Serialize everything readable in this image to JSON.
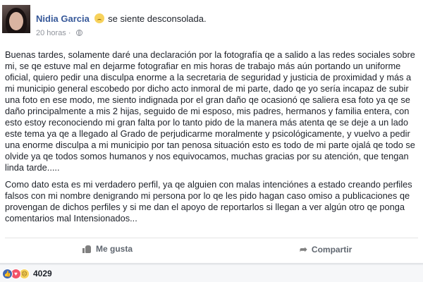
{
  "post": {
    "author_name": "Nidia Garcia",
    "feeling": "se siente desconsolada.",
    "time": "20 horas",
    "paragraphs": [
      "Buenas tardes, solamente daré una declaración por la fotografía qe a salido a las redes sociales sobre mi, se qe estuve mal en dejarme fotografiar en mis horas de trabajo más aún portando un uniforme oficial, quiero pedir una disculpa enorme a la secretaria de seguridad y justicia de proximidad y más a mi municipio general escobedo por dicho acto inmoral de mi parte, dado qe yo sería incapaz de subir una foto en ese modo, me siento indignada por el gran daño qe ocasionó qe saliera esa foto ya qe se daño principalmente a mis 2 hijas, seguido de mi esposo, mis padres, hermanos y familia entera, con esto estoy reconociendo mi gran falta por lo tanto pido de la manera más atenta qe se deje a un lado este tema ya qe a llegado al Grado de perjudicarme moralmente y psicológicamente, y vuelvo a pedir una enorme disculpa a mi municipio por tan penosa situación esto es todo de mi parte ojalá qe todo se olvide ya qe todos somos humanos y nos equivocamos, muchas gracias por su atención, que tengan linda tarde.....",
      "Como dato esta es mi verdadero perfil, ya qe alguien con malas intenciónes a estado creando perfiles falsos con mi nombre denigrando mi persona por lo qe les pido hagan caso omiso a publicaciones qe provengan de dichos perfiles y si me dan el apoyo de reportarlos si llegan a ver algún otro qe ponga comentarios mal Intensionados..."
    ],
    "actions": {
      "like_label": "Me gusta",
      "share_label": "Compartir"
    },
    "reactions": {
      "types": [
        "like-icon",
        "love-icon",
        "sad-icon"
      ],
      "count": "4029"
    }
  },
  "colors": {
    "author_link": "#365899",
    "reaction_like": "#4267b2",
    "reaction_love": "#f25268",
    "reaction_sad": "#f7d25c"
  }
}
